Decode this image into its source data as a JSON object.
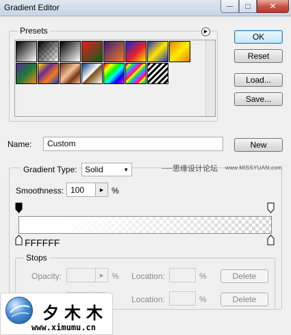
{
  "window": {
    "title": "Gradient Editor",
    "min_glyph": "—",
    "max_glyph": "□",
    "close_glyph": "✕"
  },
  "presets": {
    "label": "Presets",
    "menu_glyph": "▶"
  },
  "buttons": {
    "ok": "OK",
    "reset": "Reset",
    "load": "Load...",
    "save": "Save...",
    "new": "New"
  },
  "name_row": {
    "label": "Name:",
    "value": "Custom"
  },
  "gradient": {
    "type_label": "Gradient Type:",
    "type_value": "Solid",
    "smoothness_label": "Smoothness:",
    "smoothness_value": "100",
    "smoothness_unit": "%",
    "color_stop_value": "FFFFFF"
  },
  "stops": {
    "label": "Stops",
    "opacity_label": "Opacity:",
    "opacity_unit": "%",
    "location_label": "Location:",
    "location_unit": "%",
    "delete_label": "Delete"
  },
  "watermark": {
    "site_cn": "思缘设计论坛",
    "site_url": "www.MISSYUAN.com",
    "logo_text": "夕木木",
    "logo_url": "www.ximumu.cn"
  },
  "colors": {
    "title_bar": "#c7d4e4",
    "close_button": "#c75245",
    "default_button_border": "#3c7fb1",
    "dialog_bg": "#f0f0f0"
  }
}
